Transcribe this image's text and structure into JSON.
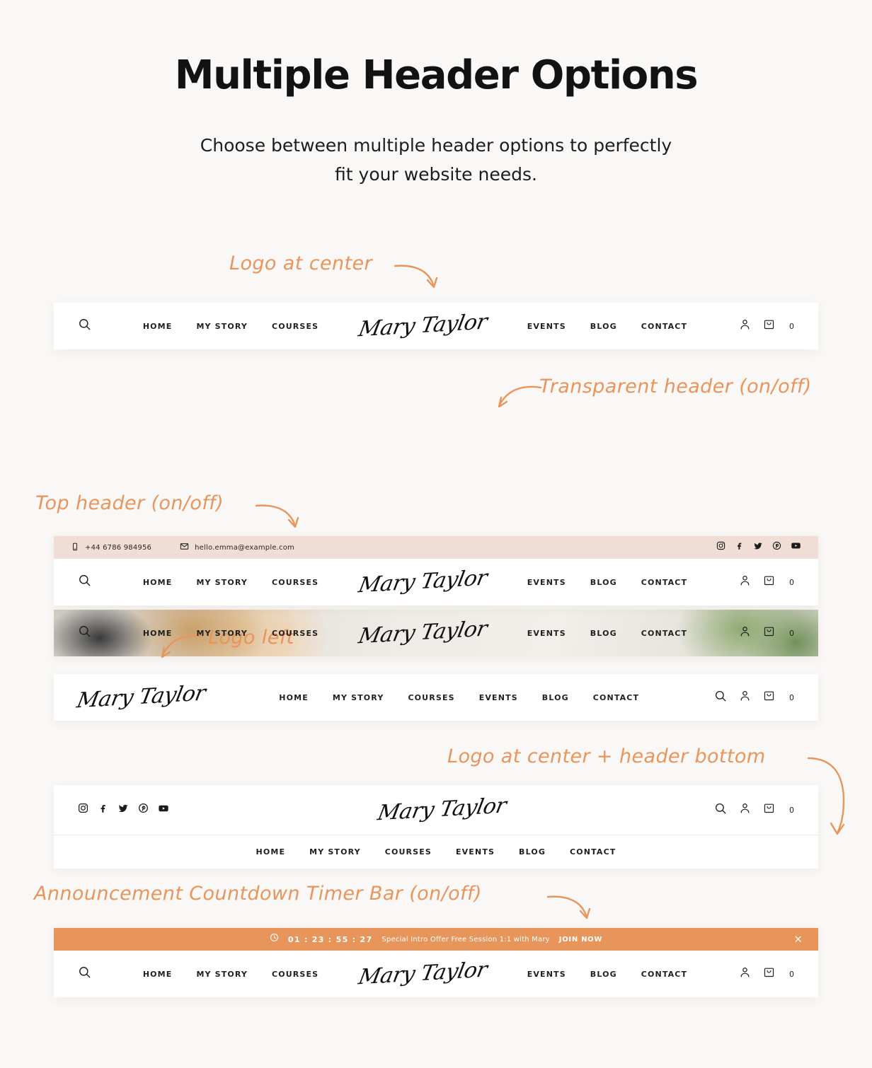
{
  "intro": {
    "title": "Multiple Header Options",
    "subtitle": "Choose between multiple header options to perfectly fit your website needs."
  },
  "brand": {
    "logo_text": "Mary Taylor",
    "accent_color": "#e8955c",
    "page_background": "#faf8f6",
    "topbar_background": "#f0ddd5"
  },
  "annotations": {
    "logo_center": "Logo at center",
    "transparent_header": "Transparent header (on/off)",
    "top_header": "Top header (on/off)",
    "logo_left": "Logo left",
    "logo_center_bottom": "Logo at center + header bottom",
    "announcement": "Announcement Countdown Timer Bar (on/off)"
  },
  "nav": {
    "left": [
      {
        "label": "HOME"
      },
      {
        "label": "MY STORY"
      },
      {
        "label": "COURSES"
      }
    ],
    "right": [
      {
        "label": "EVENTS"
      },
      {
        "label": "BLOG"
      },
      {
        "label": "CONTACT"
      }
    ],
    "full": [
      {
        "label": "HOME"
      },
      {
        "label": "MY STORY"
      },
      {
        "label": "COURSES"
      },
      {
        "label": "EVENTS"
      },
      {
        "label": "BLOG"
      },
      {
        "label": "CONTACT"
      }
    ]
  },
  "icons": {
    "search": "search-icon",
    "account": "user-icon",
    "cart": "shopping-bag-icon",
    "cart_count": "0",
    "phone": "phone-icon",
    "mail": "mail-icon",
    "clock": "clock-icon",
    "close": "×"
  },
  "topbar": {
    "phone": "+44 6786 984956",
    "email": "hello.emma@example.com",
    "socials": [
      {
        "name": "instagram-icon"
      },
      {
        "name": "facebook-icon"
      },
      {
        "name": "twitter-icon"
      },
      {
        "name": "pinterest-icon"
      },
      {
        "name": "youtube-icon"
      }
    ]
  },
  "announcement": {
    "timer": "01 : 23 : 55 : 27",
    "message": "Special Intro Offer Free Session 1:1 with Mary",
    "cta": "JOIN NOW",
    "close": "×"
  }
}
